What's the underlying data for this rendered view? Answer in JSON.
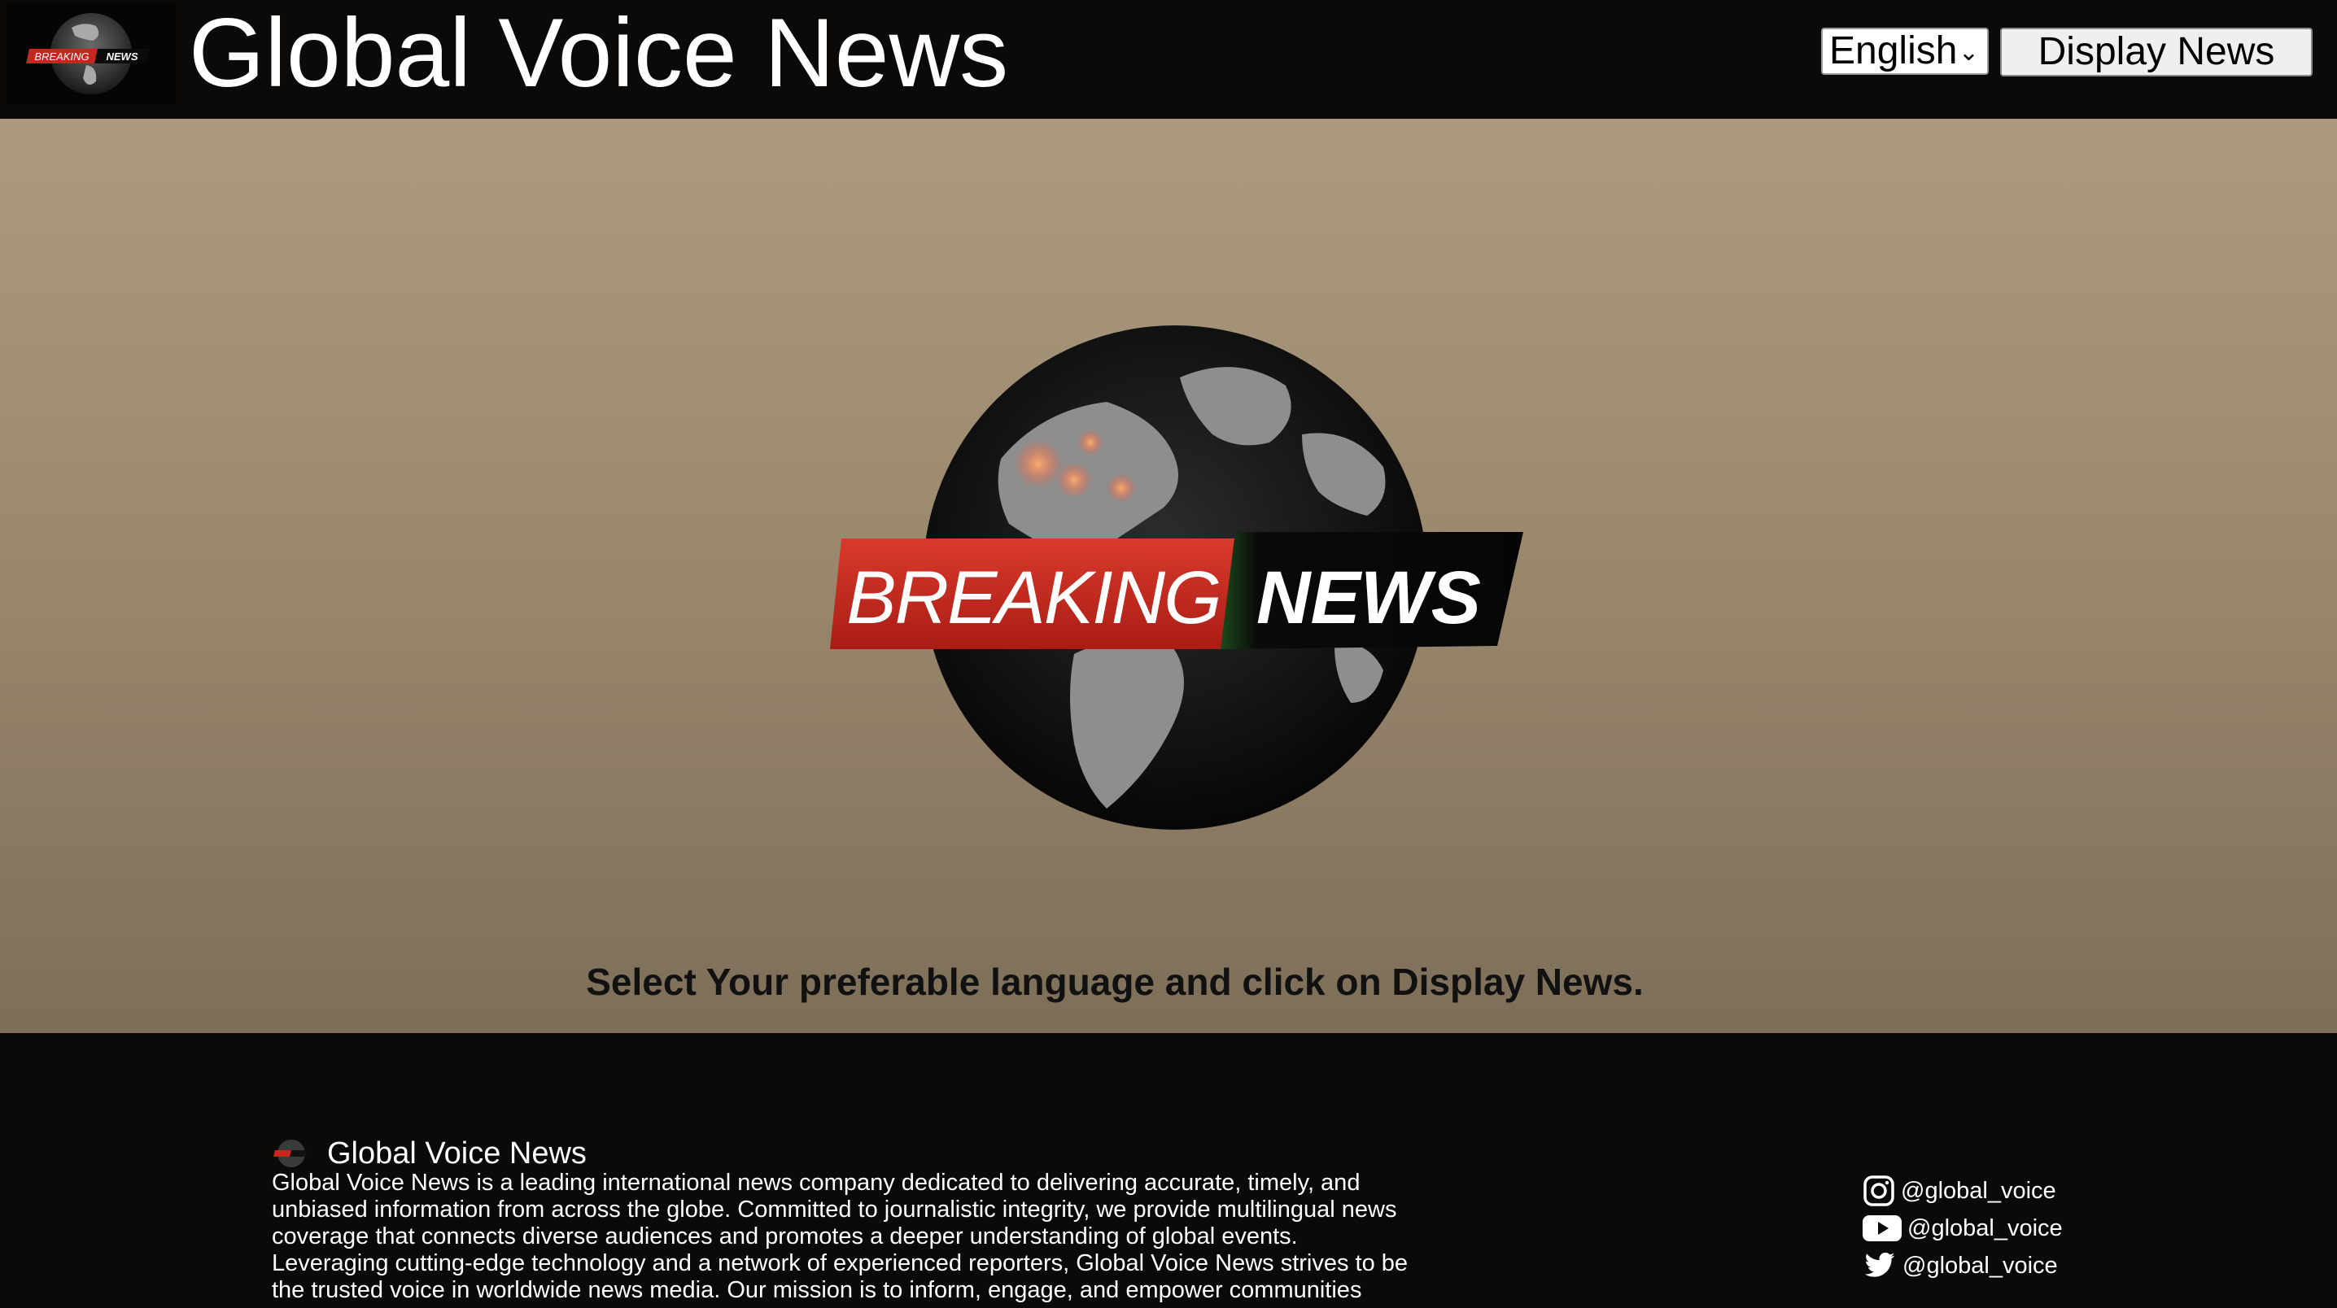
{
  "header": {
    "logo_text_left": "BREAKING",
    "logo_text_right": "NEWS",
    "title": "Global Voice News",
    "language_select": {
      "selected": "English"
    },
    "display_button_label": "Display News"
  },
  "hero": {
    "banner_left": "BREAKING",
    "banner_right": "NEWS",
    "instruction": "Select Your preferable language and click on Display News."
  },
  "footer": {
    "brand_name": "Global Voice News",
    "description": "Global Voice News is a leading international news company dedicated to delivering accurate, timely, and unbiased information from across the globe. Committed to journalistic integrity, we provide multilingual news coverage that connects diverse audiences and promotes a deeper understanding of global events. Leveraging cutting-edge technology and a network of experienced reporters, Global Voice News strives to be the trusted voice in worldwide news media. Our mission is to inform, engage, and empower communities",
    "social": [
      {
        "icon": "instagram-icon",
        "handle": "@global_voice"
      },
      {
        "icon": "youtube-icon",
        "handle": "@global_voice"
      },
      {
        "icon": "twitter-icon",
        "handle": "@global_voice"
      }
    ]
  },
  "colors": {
    "header_bg": "#0c0a08",
    "hero_top": "#ab9a80",
    "hero_bottom": "#7d6e58",
    "banner_red": "#c3281f",
    "banner_dark": "#0b0b0b"
  }
}
